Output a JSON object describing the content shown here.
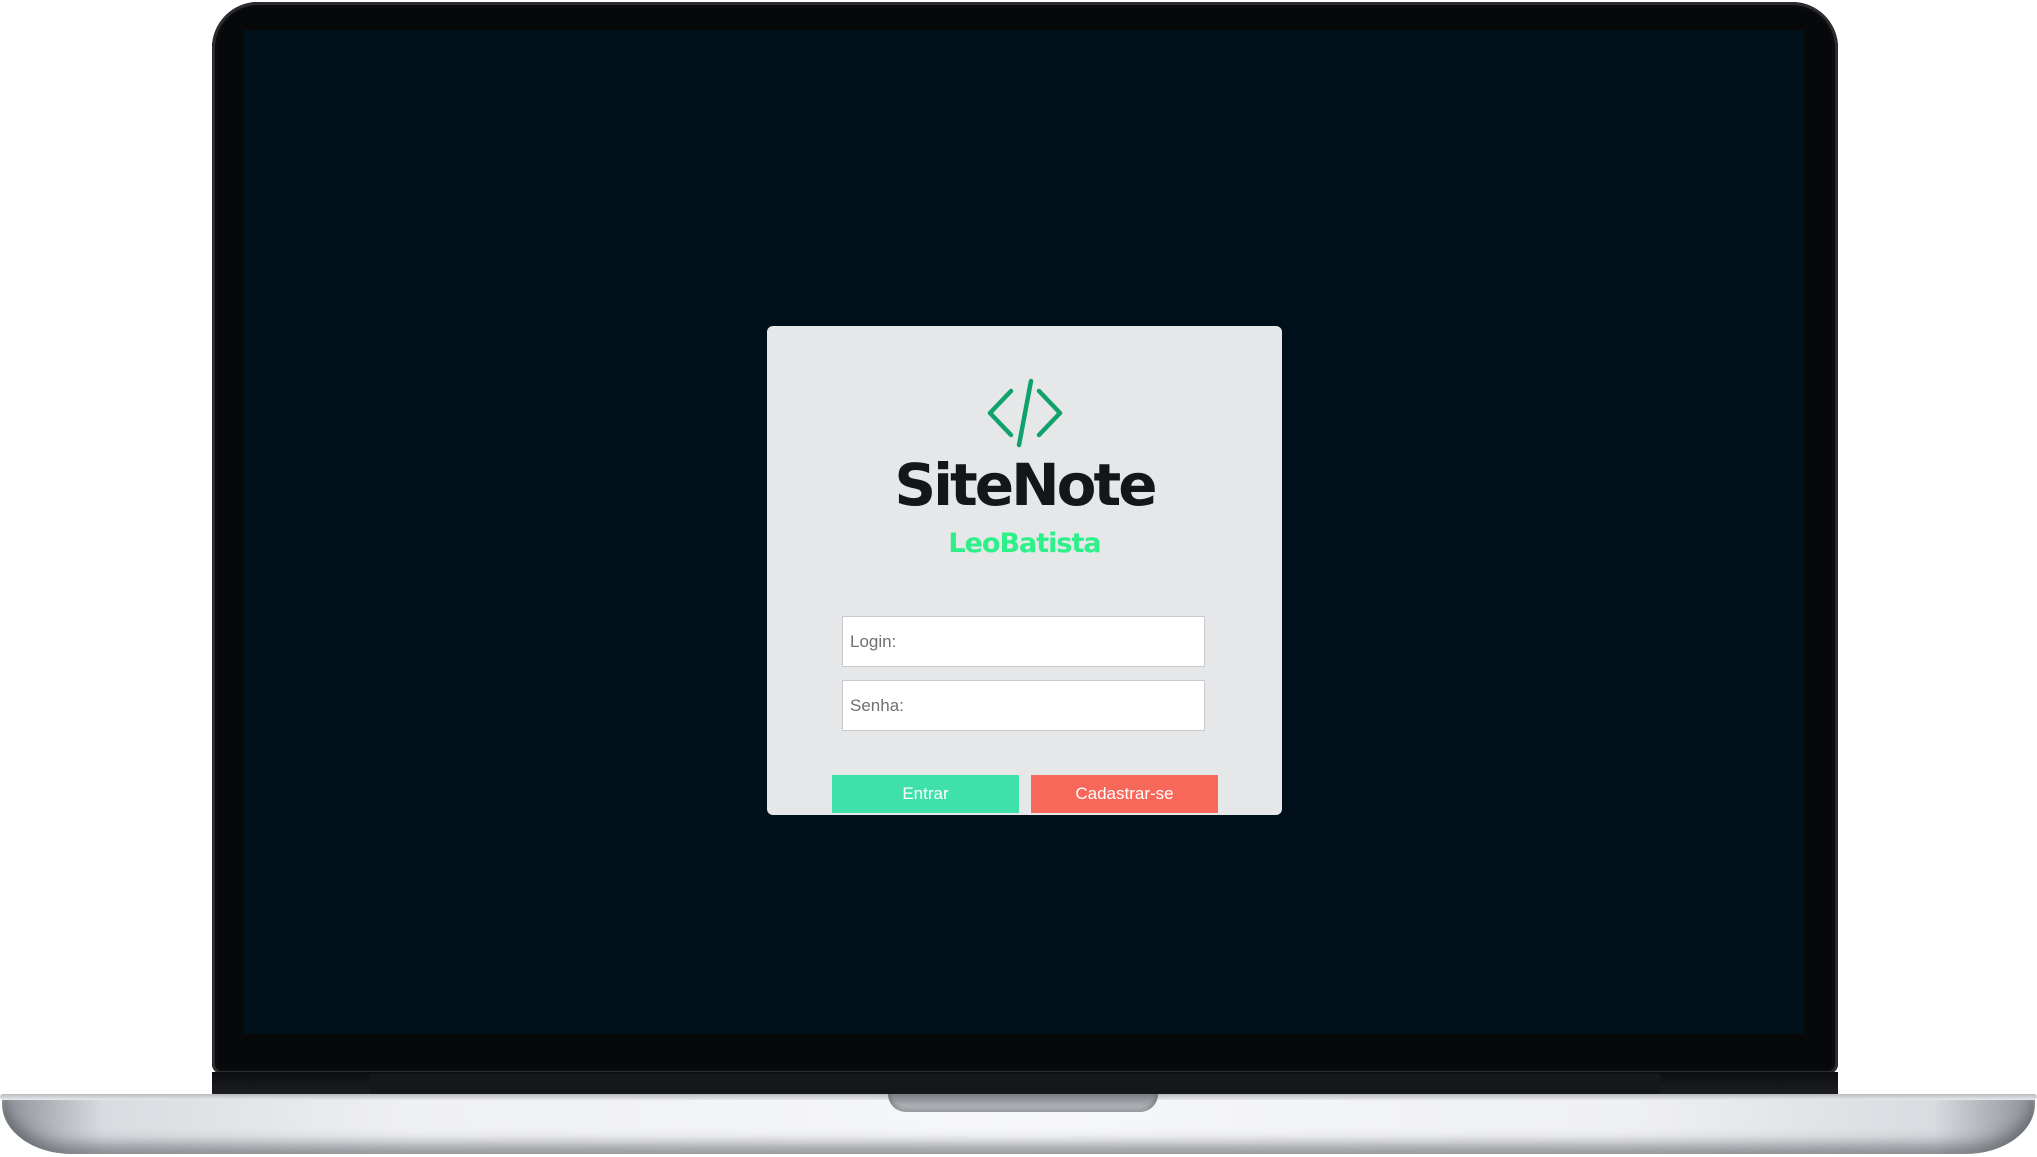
{
  "app": {
    "brand_title": "SiteNote",
    "brand_subtitle": "LeoBatista",
    "logo_icon": "code-brackets-icon"
  },
  "form": {
    "login_placeholder": "Login:",
    "login_value": "",
    "password_placeholder": "Senha:",
    "password_value": "",
    "submit_label": "Entrar",
    "register_label": "Cadastrar-se"
  },
  "colors": {
    "screen_background": "#00111c",
    "card_background": "#e5e7e9",
    "logo_green": "#0fa36b",
    "subtitle_green": "#2ef089",
    "submit_button": "#40e0aa",
    "register_button": "#f7675a"
  }
}
